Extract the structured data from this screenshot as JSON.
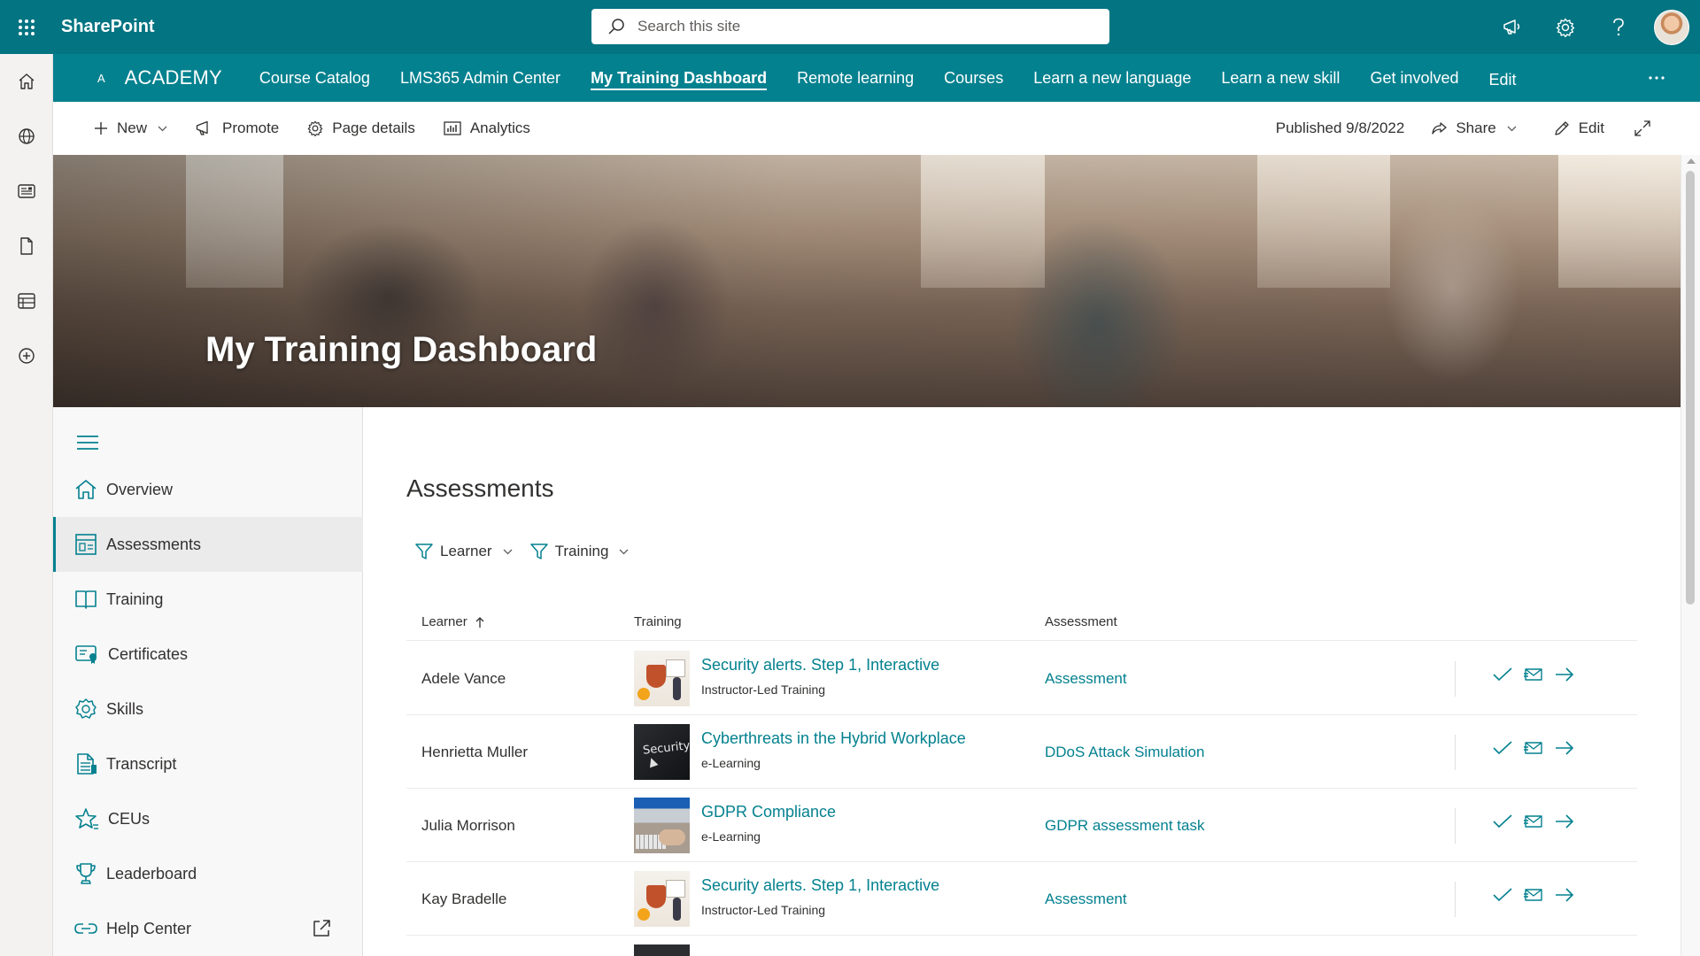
{
  "suite": {
    "brand": "SharePoint",
    "search_placeholder": "Search this site"
  },
  "hub": {
    "logo": "A",
    "site_name": "ACADEMY",
    "links": [
      {
        "label": "Course Catalog"
      },
      {
        "label": "LMS365 Admin Center"
      },
      {
        "label": "My Training Dashboard",
        "active": true
      },
      {
        "label": "Remote learning"
      },
      {
        "label": "Courses"
      },
      {
        "label": "Learn a new language"
      },
      {
        "label": "Learn a new skill"
      },
      {
        "label": "Get involved"
      },
      {
        "label": "Edit"
      }
    ]
  },
  "command_bar": {
    "new": "New",
    "promote": "Promote",
    "page_details": "Page details",
    "analytics": "Analytics",
    "published": "Published 9/8/2022",
    "share": "Share",
    "edit": "Edit"
  },
  "hero": {
    "title": "My Training Dashboard"
  },
  "sidenav": {
    "items": [
      {
        "label": "Overview",
        "icon": "home-icon"
      },
      {
        "label": "Assessments",
        "icon": "assessment-icon",
        "active": true
      },
      {
        "label": "Training",
        "icon": "book-icon"
      },
      {
        "label": "Certificates",
        "icon": "certificate-icon"
      },
      {
        "label": "Skills",
        "icon": "skills-icon"
      },
      {
        "label": "Transcript",
        "icon": "transcript-icon"
      },
      {
        "label": "CEUs",
        "icon": "star-icon"
      },
      {
        "label": "Leaderboard",
        "icon": "trophy-icon"
      },
      {
        "label": "Help Center",
        "icon": "link-icon"
      }
    ]
  },
  "assessments": {
    "title": "Assessments",
    "filters": {
      "learner": "Learner",
      "training": "Training"
    },
    "columns": {
      "learner": "Learner",
      "training": "Training",
      "assessment": "Assessment"
    },
    "rows": [
      {
        "learner": "Adele Vance",
        "training": "Security alerts. Step 1, Interactive",
        "type": "Instructor-Led Training",
        "assessment": "Assessment",
        "thumb": "security"
      },
      {
        "learner": "Henrietta Muller",
        "training": "Cyberthreats in the Hybrid Workplace",
        "type": "e-Learning",
        "assessment": "DDoS Attack Simulation",
        "thumb": "cyber"
      },
      {
        "learner": "Julia Morrison",
        "training": "GDPR Compliance",
        "type": "e-Learning",
        "assessment": "GDPR assessment task",
        "thumb": "gdpr"
      },
      {
        "learner": "Kay Bradelle",
        "training": "Security alerts. Step 1, Interactive",
        "type": "Instructor-Led Training",
        "assessment": "Assessment",
        "thumb": "security"
      }
    ],
    "thumb_text": {
      "cyber": "Security"
    }
  },
  "colors": {
    "suite_bar": "#037481",
    "hub_nav": "#04818f",
    "link": "#04818f"
  }
}
